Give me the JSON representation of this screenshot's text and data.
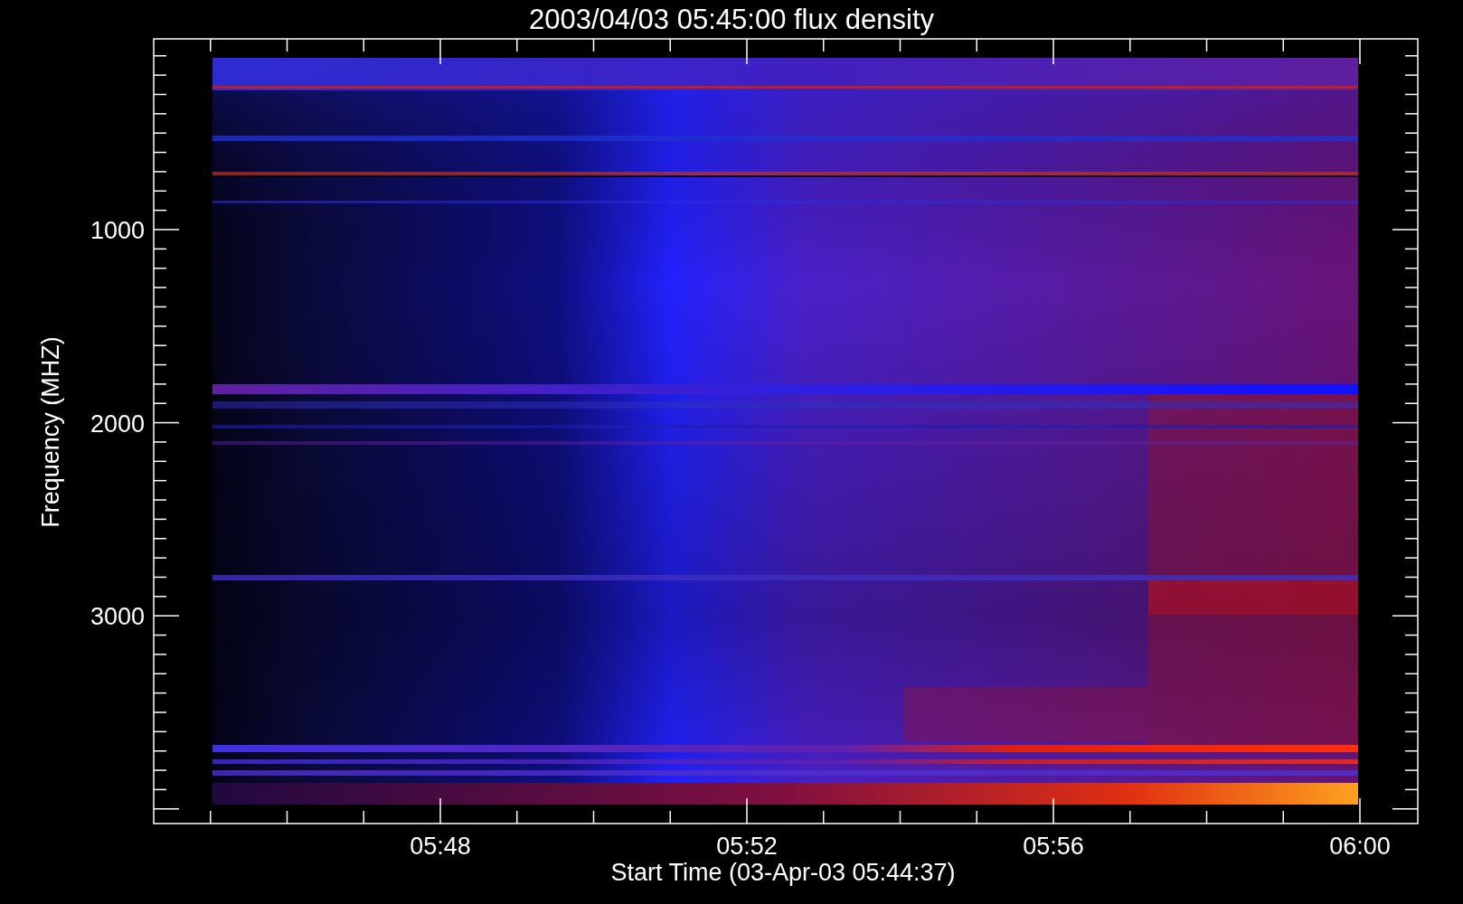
{
  "title": "2003/04/03 05:45:00 flux density",
  "y_axis": {
    "label": "Frequency (MHZ)",
    "ticks": [
      "1000",
      "2000",
      "3000"
    ]
  },
  "x_axis": {
    "label": "Start Time (03-Apr-03 05:44:37)",
    "ticks": [
      "05:48",
      "05:52",
      "05:56",
      "06:00"
    ]
  }
}
